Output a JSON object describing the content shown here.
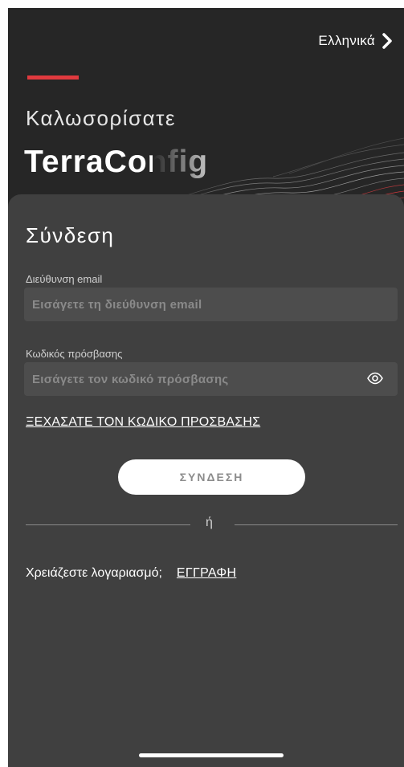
{
  "header": {
    "language_label": "Ελληνικά",
    "welcome_text": "Καλωσορίσατε",
    "app_name": "TerraConfig"
  },
  "login": {
    "title": "Σύνδεση",
    "email_label": "Διεύθυνση email",
    "email_placeholder": "Εισάγετε τη διεύθυνση email",
    "password_label": "Κωδικός πρόσβασης",
    "password_placeholder": "Εισάγετε τον κωδικό πρόσβασης",
    "forgot_password": "ΞΕΧΑΣΑΤΕ ΤΟΝ ΚΩΔΙΚΟ ΠΡΟΣΒΑΣΗΣ",
    "submit_label": "ΣΥΝΔΕΣΗ",
    "divider_text": "ή",
    "signup_prompt": "Χρειάζεστε λογαριασμό;",
    "signup_link": "ΕΓΓΡΑΦΗ"
  },
  "icons": {
    "language": "chevron-right-icon",
    "password_toggle": "eye-icon"
  },
  "colors": {
    "background": "#262626",
    "card": "#404040",
    "input": "#4d4d4d",
    "accent": "#e03a3e",
    "button": "#ffffff",
    "button_text": "#8c8c8c"
  }
}
